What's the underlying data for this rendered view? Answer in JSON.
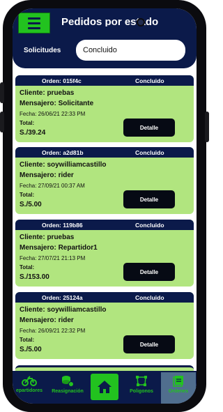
{
  "header": {
    "title": "Pedidos por estado",
    "filter_label": "Solicitudes",
    "filter_value": "Concluido"
  },
  "orders": [
    {
      "id": "Orden: 015f4c",
      "status": "Concluido",
      "client": "Cliente: pruebas",
      "courier": "Mensajero: Solicitante",
      "date": "Fecha: 26/06/21 22:33 PM",
      "total_label": "Total:",
      "total": "S./39.24",
      "button": "Detalle"
    },
    {
      "id": "Orden: a2d81b",
      "status": "Concluido",
      "client": "Cliente: soywilliamcastillo",
      "courier": "Mensajero: rider",
      "date": "Fecha: 27/09/21 00:37 AM",
      "total_label": "Total:",
      "total": "S./5.00",
      "button": "Detalle"
    },
    {
      "id": "Orden: 119b86",
      "status": "Concluido",
      "client": "Cliente: pruebas",
      "courier": "Mensajero: Repartidor1",
      "date": "Fecha: 27/07/21 21:13 PM",
      "total_label": "Total:",
      "total": "S./153.00",
      "button": "Detalle"
    },
    {
      "id": "Orden: 25124a",
      "status": "Concluido",
      "client": "Cliente: soywilliamcastillo",
      "courier": "Mensajero: rider",
      "date": "Fecha: 26/09/21 22:32 PM",
      "total_label": "Total:",
      "total": "S./5.00",
      "button": "Detalle"
    }
  ],
  "nav": {
    "repartidores": "epartidores",
    "reasignacion": "Reasignación",
    "poligonos": "Poligonos",
    "ordenes": "Ordenes"
  },
  "colors": {
    "navy": "#0b1a4a",
    "green": "#22c21f",
    "card": "#b1e57f"
  }
}
